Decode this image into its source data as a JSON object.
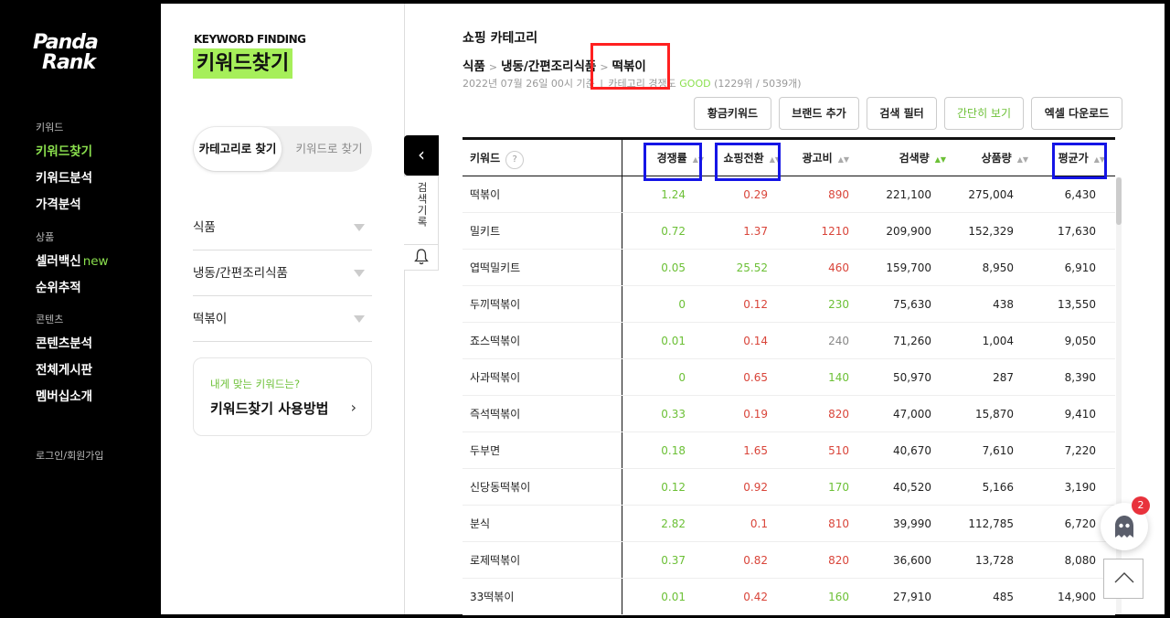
{
  "sidebar": {
    "logo_line1": "Panda",
    "logo_line2": "Rank",
    "sections": [
      {
        "title": "키워드",
        "items": [
          "키워드찾기",
          "키워드분석",
          "가격분석"
        ]
      },
      {
        "title": "상품",
        "items": [
          "셀러백신",
          "순위추적"
        ],
        "new_badge": "new"
      },
      {
        "title": "콘텐츠",
        "items": [
          "콘텐츠분석",
          "전체게시판",
          "멤버십소개"
        ]
      }
    ],
    "login": "로그인/회원가입"
  },
  "keyword_panel": {
    "title_eng": "KEYWORD FINDING",
    "title_kor": "키워드찾기",
    "toggle_on": "카테고리로 찾기",
    "toggle_off": "키워드로 찾기",
    "categories": [
      "식품",
      "냉동/간편조리식품",
      "떡볶이"
    ],
    "howto_sub": "내게 맞는 키워드는?",
    "howto_main": "키워드찾기 사용방법",
    "history_label": "검색기록"
  },
  "main": {
    "title": "쇼핑 카테고리",
    "crumbs": [
      "식품",
      "냉동/간편조리식품",
      "떡볶이"
    ],
    "crumb_sep": ">",
    "meta_date": "2022년 07월 26일 00시 기준",
    "meta_label": "카테고리 경쟁도",
    "meta_good": "GOOD",
    "meta_rank": "(1229위 / 5039개)",
    "buttons": [
      "황금키워드",
      "브랜드 추가",
      "검색 필터",
      "간단히 보기",
      "엑셀 다운로드"
    ]
  },
  "table": {
    "columns": [
      "키워드",
      "경쟁률",
      "쇼핑전환",
      "광고비",
      "검색량",
      "상품량",
      "평균가"
    ],
    "qmark": "?",
    "rows": [
      [
        "떡볶이",
        "1.24",
        "0.29",
        "890",
        "221,100",
        "275,004",
        "6,430"
      ],
      [
        "밀키트",
        "0.72",
        "1.37",
        "1210",
        "209,900",
        "152,329",
        "17,630"
      ],
      [
        "엽떡밀키트",
        "0.05",
        "25.52",
        "460",
        "159,700",
        "8,950",
        "6,910"
      ],
      [
        "두끼떡볶이",
        "0",
        "0.12",
        "230",
        "75,630",
        "438",
        "13,550"
      ],
      [
        "죠스떡볶이",
        "0.01",
        "0.14",
        "240",
        "71,260",
        "1,004",
        "9,050"
      ],
      [
        "사과떡볶이",
        "0",
        "0.65",
        "140",
        "50,970",
        "287",
        "8,390"
      ],
      [
        "즉석떡볶이",
        "0.33",
        "0.19",
        "820",
        "47,000",
        "15,870",
        "9,410"
      ],
      [
        "두부면",
        "0.18",
        "1.65",
        "510",
        "40,670",
        "7,610",
        "7,220"
      ],
      [
        "신당동떡볶이",
        "0.12",
        "0.92",
        "170",
        "40,520",
        "5,166",
        "3,190"
      ],
      [
        "분식",
        "2.82",
        "0.1",
        "810",
        "39,990",
        "112,785",
        "6,720"
      ],
      [
        "로제떡볶이",
        "0.37",
        "0.82",
        "820",
        "36,600",
        "13,728",
        "8,080"
      ],
      [
        "33떡볶이",
        "0.01",
        "0.42",
        "160",
        "27,910",
        "485",
        "14,900"
      ]
    ],
    "conv_colors": [
      "red",
      "red",
      "green",
      "red",
      "red",
      "red",
      "red",
      "red",
      "red",
      "red",
      "red",
      "red"
    ],
    "ad_colors": [
      "red",
      "red",
      "red",
      "green",
      "gray",
      "green",
      "red",
      "red",
      "green",
      "red",
      "red",
      "green"
    ]
  },
  "chat": {
    "badge": "2"
  },
  "colors": {
    "accent": "#8be04e",
    "red": "#d9453a",
    "green": "#6cc036",
    "gray": "#888888",
    "highlight_red": "#ff2020",
    "highlight_blue": "#1515e6"
  }
}
